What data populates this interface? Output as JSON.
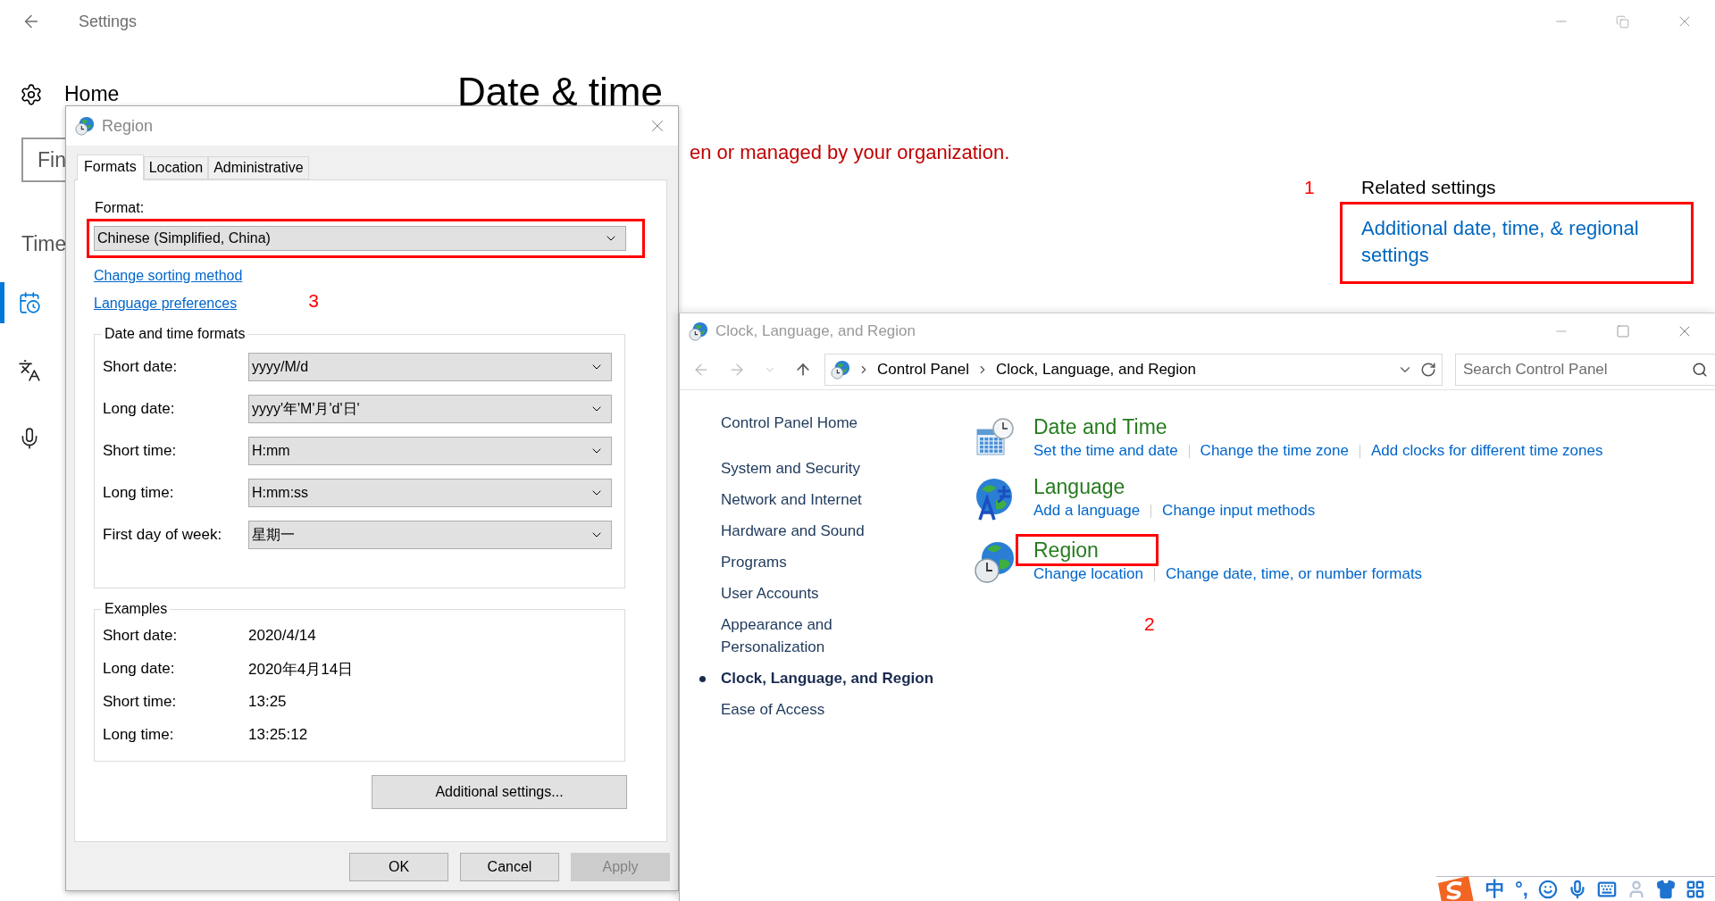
{
  "settings": {
    "title": "Settings",
    "home": "Home",
    "search_placeholder": "Fin",
    "section": "Time",
    "nav": [
      {
        "selected": true
      },
      {
        "selected": false
      },
      {
        "selected": false
      }
    ],
    "heading": "Date & time",
    "notice": "en or managed by your organization.",
    "related": {
      "heading": "Related settings",
      "link": "Additional date, time, & regional settings",
      "highlighted": true,
      "marker": "1"
    }
  },
  "region_dialog": {
    "title": "Region",
    "tabs": [
      {
        "label": "Formats",
        "selected": true
      },
      {
        "label": "Location",
        "selected": false
      },
      {
        "label": "Administrative",
        "selected": false
      }
    ],
    "format_label": "Format:",
    "format_value": "Chinese (Simplified, China)",
    "format_highlighted": true,
    "links": [
      "Change sorting method",
      "Language preferences"
    ],
    "marker": "3",
    "formats_title": "Date and time formats",
    "formats": [
      {
        "label": "Short date:",
        "value": "yyyy/M/d"
      },
      {
        "label": "Long date:",
        "value": "yyyy'年'M'月'd'日'"
      },
      {
        "label": "Short time:",
        "value": "H:mm"
      },
      {
        "label": "Long time:",
        "value": "H:mm:ss"
      },
      {
        "label": "First day of week:",
        "value": "星期一"
      }
    ],
    "examples_title": "Examples",
    "examples": [
      {
        "label": "Short date:",
        "value": "2020/4/14"
      },
      {
        "label": "Long date:",
        "value": "2020年4月14日"
      },
      {
        "label": "Short time:",
        "value": "13:25"
      },
      {
        "label": "Long time:",
        "value": "13:25:12"
      }
    ],
    "additional_button": "Additional settings...",
    "buttons": [
      {
        "label": "OK",
        "disabled": false
      },
      {
        "label": "Cancel",
        "disabled": false
      },
      {
        "label": "Apply",
        "disabled": true
      }
    ]
  },
  "control_panel": {
    "title": "Clock, Language, and Region",
    "breadcrumb": [
      "Control Panel",
      "Clock, Language, and Region"
    ],
    "search_placeholder": "Search Control Panel",
    "nav": [
      {
        "label": "Control Panel Home",
        "selected": false
      },
      {
        "label": "System and Security",
        "selected": false
      },
      {
        "label": "Network and Internet",
        "selected": false
      },
      {
        "label": "Hardware and Sound",
        "selected": false
      },
      {
        "label": "Programs",
        "selected": false
      },
      {
        "label": "User Accounts",
        "selected": false
      },
      {
        "label": "Appearance and Personalization",
        "selected": false
      },
      {
        "label": "Clock, Language, and Region",
        "selected": true
      },
      {
        "label": "Ease of Access",
        "selected": false
      }
    ],
    "categories": [
      {
        "kind": "datetime",
        "title": "Date and Time",
        "highlighted": false,
        "links": [
          "Set the time and date",
          "Change the time zone",
          "Add clocks for different time zones"
        ]
      },
      {
        "kind": "language",
        "title": "Language",
        "highlighted": false,
        "links": [
          "Add a language",
          "Change input methods"
        ]
      },
      {
        "kind": "region",
        "title": "Region",
        "highlighted": true,
        "marker": "2",
        "links": [
          "Change location",
          "Change date, time, or number formats"
        ]
      }
    ]
  },
  "ime_bar": {
    "chars": [
      "中",
      "°,"
    ]
  }
}
